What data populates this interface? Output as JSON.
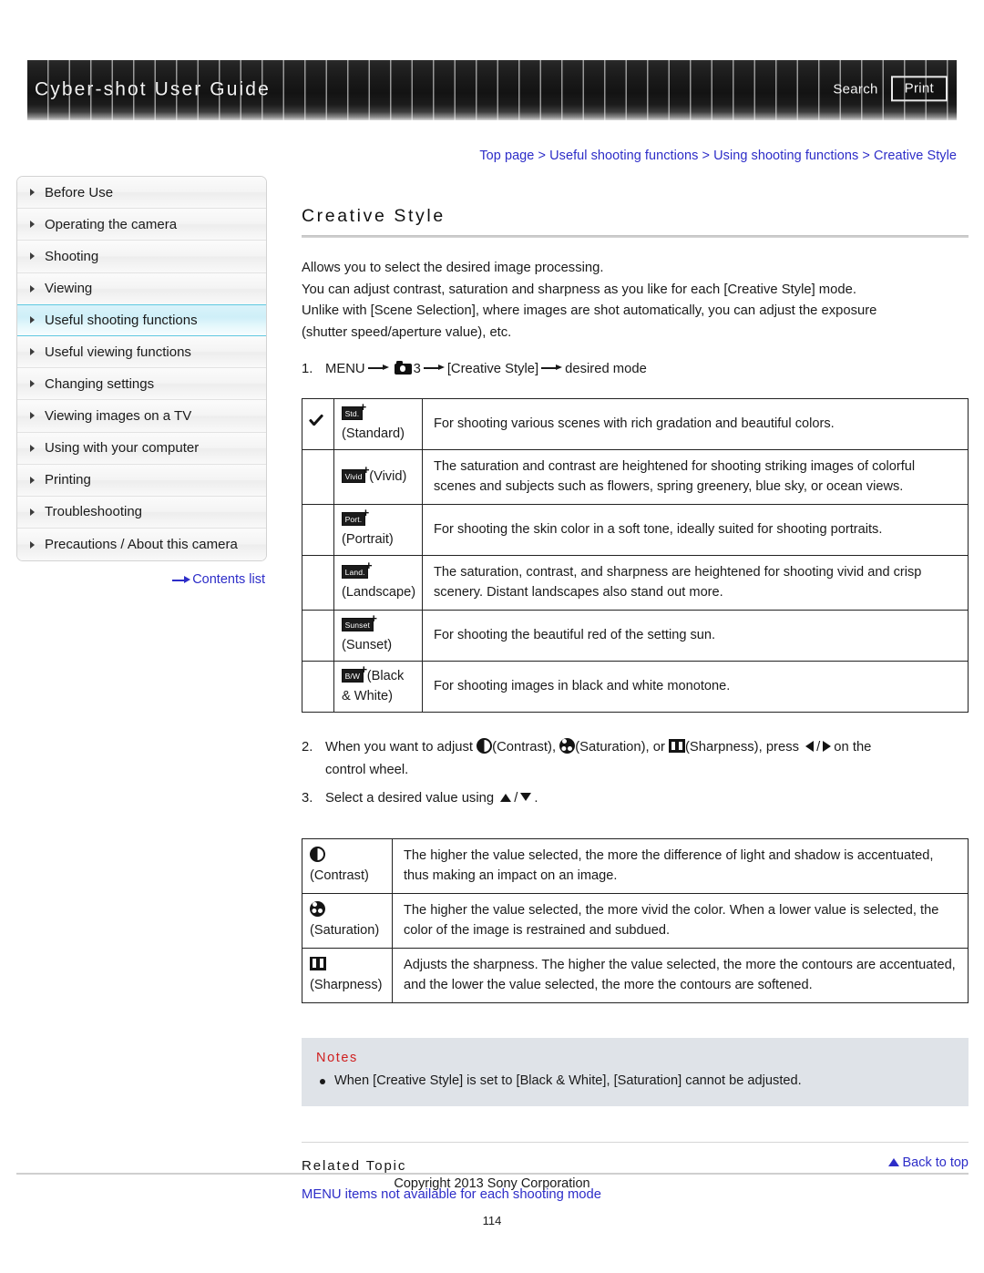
{
  "header": {
    "title": "Cyber-shot User Guide",
    "search_label": "Search",
    "print_label": "Print"
  },
  "breadcrumb": {
    "items": [
      "Top page",
      "Useful shooting functions",
      "Using shooting functions",
      "Creative Style"
    ],
    "separator": ">"
  },
  "sidebar": {
    "items": [
      {
        "label": "Before Use",
        "active": false
      },
      {
        "label": "Operating the camera",
        "active": false
      },
      {
        "label": "Shooting",
        "active": false
      },
      {
        "label": "Viewing",
        "active": false
      },
      {
        "label": "Useful shooting functions",
        "active": true
      },
      {
        "label": "Useful viewing functions",
        "active": false
      },
      {
        "label": "Changing settings",
        "active": false
      },
      {
        "label": "Viewing images on a TV",
        "active": false
      },
      {
        "label": "Using with your computer",
        "active": false
      },
      {
        "label": "Printing",
        "active": false
      },
      {
        "label": "Troubleshooting",
        "active": false
      },
      {
        "label": "Precautions / About this camera",
        "active": false
      }
    ],
    "contents_list_label": "Contents list"
  },
  "main": {
    "page_title": "Creative Style",
    "intro_lines": [
      "Allows you to select the desired image processing.",
      "You can adjust contrast, saturation and sharpness as you like for each [Creative Style] mode.",
      "Unlike with [Scene Selection], where images are shot automatically, you can adjust the exposure",
      "(shutter speed/aperture value), etc."
    ],
    "step1": {
      "number": "1.",
      "menu_label": "MENU",
      "menu_number": "3",
      "item_label": "[Creative Style]",
      "result_label": "desired mode"
    },
    "style_table": {
      "rows": [
        {
          "checked": true,
          "badge": "Std.",
          "mode": "(Standard)",
          "mode_inline": false,
          "desc": "For shooting various scenes with rich gradation and beautiful colors."
        },
        {
          "checked": false,
          "badge": "Vivid",
          "mode": "(Vivid)",
          "mode_inline": true,
          "desc": "The saturation and contrast are heightened for shooting striking images of colorful scenes and subjects such as flowers, spring greenery, blue sky, or ocean views."
        },
        {
          "checked": false,
          "badge": "Port.",
          "mode": "(Portrait)",
          "mode_inline": false,
          "desc": "For shooting the skin color in a soft tone, ideally suited for shooting portraits."
        },
        {
          "checked": false,
          "badge": "Land.",
          "mode": "(Landscape)",
          "mode_inline": false,
          "desc": "The saturation, contrast, and sharpness are heightened for shooting vivid and crisp scenery. Distant landscapes also stand out more."
        },
        {
          "checked": false,
          "badge": "Sunset",
          "mode": "(Sunset)",
          "mode_inline": false,
          "desc": "For shooting the beautiful red of the setting sun."
        },
        {
          "checked": false,
          "badge": "B/W",
          "mode": "(Black & White)",
          "mode_inline": true,
          "desc": "For shooting images in black and white monotone."
        }
      ]
    },
    "step2": {
      "number": "2.",
      "text_a": "When you want to adjust",
      "label_contrast": "(Contrast),",
      "label_saturation": "(Saturation), or",
      "label_sharpness": "(Sharpness), press",
      "slash": "/",
      "text_b": "on the",
      "text_c": "control wheel."
    },
    "step3": {
      "number": "3.",
      "text_a": "Select a desired value using",
      "slash": "/",
      "text_b": "."
    },
    "param_table": {
      "rows": [
        {
          "icon": "contrast-icon",
          "name": "(Contrast)",
          "desc": "The higher the value selected, the more the difference of light and shadow is accentuated, thus making an impact on an image."
        },
        {
          "icon": "saturation-icon",
          "name": "(Saturation)",
          "desc": "The higher the value selected, the more vivid the color. When a lower value is selected, the color of the image is restrained and subdued."
        },
        {
          "icon": "sharpness-icon",
          "name": "(Sharpness)",
          "desc": "Adjusts the sharpness. The higher the value selected, the more the contours are accentuated, and the lower the value selected, the more the contours are softened."
        }
      ]
    },
    "notes": {
      "title": "Notes",
      "items": [
        "When [Creative Style] is set to [Black & White], [Saturation] cannot be adjusted."
      ]
    },
    "related": {
      "title": "Related Topic",
      "links": [
        "MENU items not available for each shooting mode"
      ]
    }
  },
  "footer": {
    "back_to_top": "Back to top",
    "copyright": "Copyright 2013 Sony Corporation",
    "page_number": "114"
  },
  "colors": {
    "link": "#2d2dc8",
    "notes_title": "#cf2020",
    "notes_bg": "#dfe3e8",
    "sidebar_active_border": "#5fc8e0",
    "header_dark": "#131313"
  }
}
